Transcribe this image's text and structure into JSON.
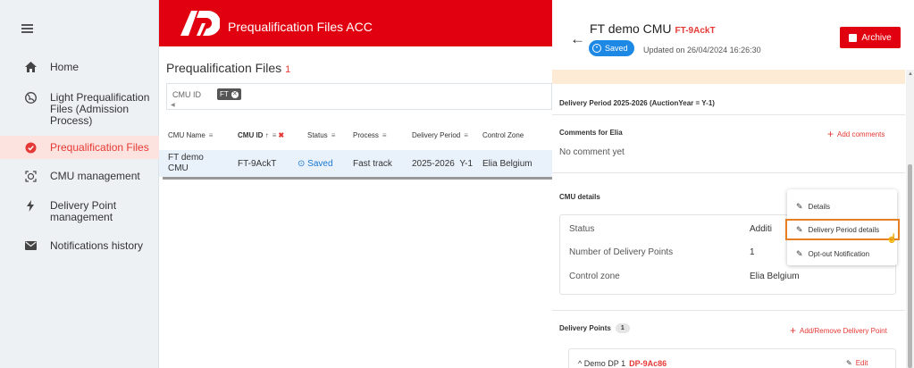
{
  "sidebar": {
    "items": [
      {
        "label": "Home",
        "icon": "home-icon"
      },
      {
        "label": "Light Prequalification Files (Admission Process)",
        "icon": "globe-icon"
      },
      {
        "label": "Prequalification Files",
        "icon": "verified-badge-icon"
      },
      {
        "label": "CMU management",
        "icon": "target-icon"
      },
      {
        "label": "Delivery Point management",
        "icon": "bolt-icon"
      },
      {
        "label": "Notifications history",
        "icon": "mail-icon"
      }
    ],
    "active_index": 2
  },
  "topbar": {
    "app_title": "Prequalification Files ACC",
    "brand_color": "#e1000f"
  },
  "page": {
    "title": "Prequalification Files",
    "count": "1"
  },
  "filter": {
    "label": "CMU ID",
    "chip": "FT"
  },
  "table": {
    "headers": [
      "CMU Name",
      "CMU ID",
      "Status",
      "Process",
      "Delivery Period",
      "Control Zone"
    ],
    "row": {
      "cmu_name": "FT demo CMU",
      "cmu_id": "FT-9AckT",
      "status": "Saved",
      "process": "Fast track",
      "delivery_period": "2025-2026",
      "year": "Y-1",
      "control_zone": "Elia Belgium"
    }
  },
  "panel": {
    "title": "FT demo CMU",
    "code": "FT-9AckT",
    "status": "Saved",
    "updated": "Updated on 26/04/2024 16:26:30",
    "archive_label": "Archive",
    "delivery_period_title": "Delivery Period 2025-2026 (AuctionYear = Y-1)",
    "comments_title": "Comments for Elia",
    "add_comments": "Add comments",
    "no_comment": "No comment yet",
    "cmu_details_title": "CMU details",
    "details": [
      {
        "label": "Status",
        "value": "Additi"
      },
      {
        "label": "Number of Delivery Points",
        "value": "1"
      },
      {
        "label": "Control zone",
        "value": "Elia Belgium"
      }
    ],
    "menu": [
      "Details",
      "Delivery Period details",
      "Opt-out Notification"
    ],
    "delivery_points_title": "Delivery Points",
    "delivery_points_count": "1",
    "add_remove_dp": "Add/Remove Delivery Point",
    "dp_name": "Demo DP 1",
    "dp_code": "DP-9Ac86",
    "edit_label": "Edit"
  }
}
